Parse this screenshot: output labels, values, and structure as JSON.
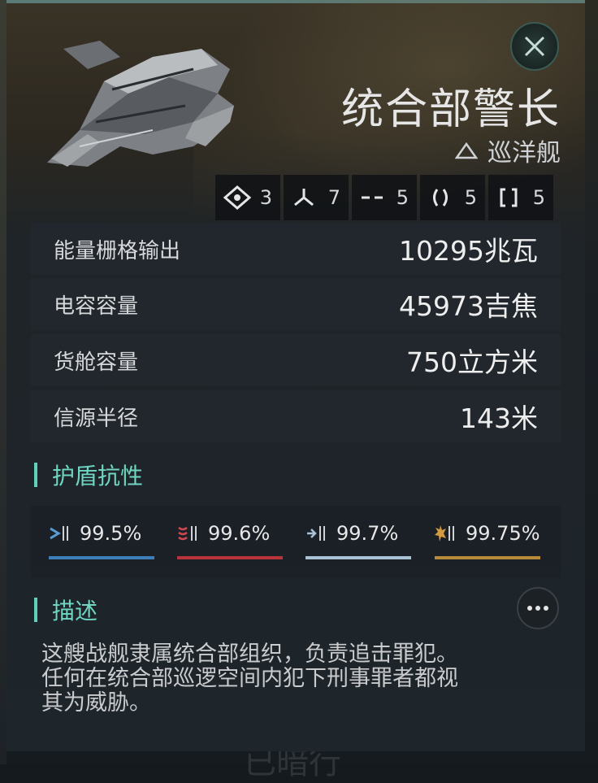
{
  "ship": {
    "name": "统合部警长",
    "class_label": "巡洋舰",
    "class_icon": "hull-class-icon"
  },
  "slots": [
    {
      "icon": "drone-icon",
      "value": "3"
    },
    {
      "icon": "turret-icon",
      "value": "7"
    },
    {
      "icon": "low-slot-icon",
      "value": "5"
    },
    {
      "icon": "mid-slot-icon",
      "value": "5"
    },
    {
      "icon": "high-slot-icon",
      "value": "5"
    }
  ],
  "stats": [
    {
      "label": "能量栅格输出",
      "value": "10295兆瓦"
    },
    {
      "label": "电容容量",
      "value": "45973吉焦"
    },
    {
      "label": "货舱容量",
      "value": "750立方米"
    },
    {
      "label": "信源半径",
      "value": "143米"
    }
  ],
  "shield_section": {
    "title": "护盾抗性",
    "resists": [
      {
        "icon": "em-resist-icon",
        "value": "99.5%",
        "color": "#3d7fb8"
      },
      {
        "icon": "thermal-resist-icon",
        "value": "99.6%",
        "color": "#b8343a"
      },
      {
        "icon": "kinetic-resist-icon",
        "value": "99.7%",
        "color": "#a9c2d4"
      },
      {
        "icon": "explosive-resist-icon",
        "value": "99.75%",
        "color": "#b88b3a"
      }
    ]
  },
  "description_section": {
    "title": "描述",
    "text_lines": [
      "这艘战舰隶属统合部组织，负责追击罪犯。",
      "任何在统合部巡逻空间内犯下刑事罪者都视",
      "其为威胁。"
    ]
  },
  "background_text": "已暗行",
  "colors": {
    "accent": "#5ed1bb",
    "panel": "#1e252b"
  }
}
